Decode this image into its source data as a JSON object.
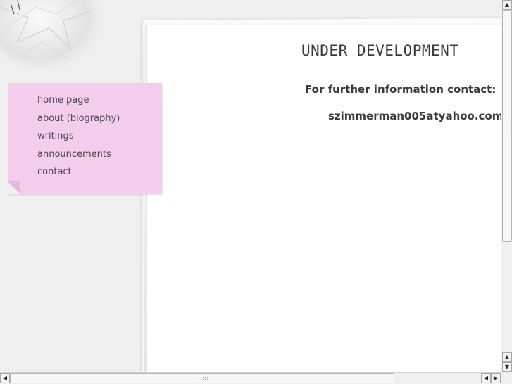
{
  "main": {
    "heading": "UNDER DEVELOPMENT",
    "contact_intro": "For further information contact:",
    "contact_email": "szimmerman005atyahoo.com"
  },
  "nav": {
    "items": [
      {
        "label": "home page"
      },
      {
        "label": "about (biography)"
      },
      {
        "label": "writings"
      },
      {
        "label": "announcements"
      },
      {
        "label": "contact"
      }
    ]
  },
  "scrollbars": {
    "up_arrow": "▲",
    "down_arrow": "▼",
    "left_arrow": "◀",
    "right_arrow": "▶"
  },
  "colors": {
    "sticky_note": "#f4cdec",
    "page_background": "#efefef",
    "text": "#3a3a3a"
  }
}
